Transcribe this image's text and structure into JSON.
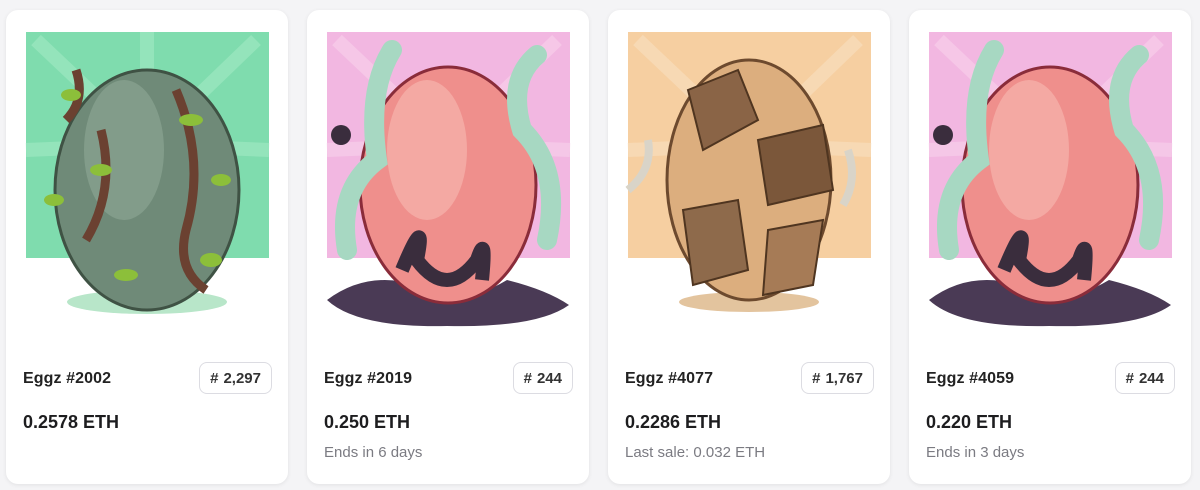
{
  "cards": [
    {
      "name": "Eggz #2002",
      "rank_symbol": "#",
      "rank": "2,297",
      "price": "0.2578 ETH",
      "sub": "",
      "bg": "#7fdcae",
      "egg": "green-vine-egg"
    },
    {
      "name": "Eggz #2019",
      "rank_symbol": "#",
      "rank": "244",
      "price": "0.250 ETH",
      "sub": "Ends in 6 days",
      "bg": "#f2b7e1",
      "egg": "pink-tentacle-egg"
    },
    {
      "name": "Eggz #4077",
      "rank_symbol": "#",
      "rank": "1,767",
      "price": "0.2286 ETH",
      "sub": "Last sale: 0.032 ETH",
      "bg": "#f6cfa1",
      "egg": "rock-egg"
    },
    {
      "name": "Eggz #4059",
      "rank_symbol": "#",
      "rank": "244",
      "price": "0.220 ETH",
      "sub": "Ends in 3 days",
      "bg": "#f2b7e1",
      "egg": "pink-tentacle-egg"
    }
  ]
}
